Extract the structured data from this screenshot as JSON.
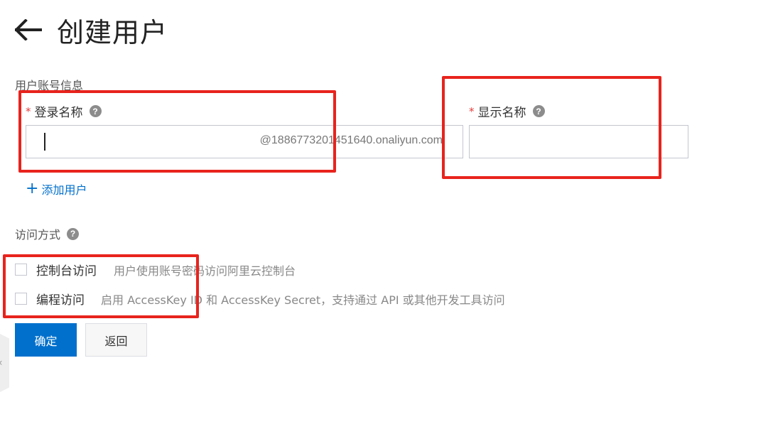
{
  "header": {
    "title": "创建用户"
  },
  "account_section": {
    "title": "用户账号信息"
  },
  "login_name": {
    "label": "登录名称",
    "required_mark": "*",
    "value": "",
    "suffix": "@1886773201451640.onaliyun.com"
  },
  "display_name": {
    "label": "显示名称",
    "required_mark": "*",
    "value": ""
  },
  "add_user": {
    "label": "添加用户"
  },
  "access_section": {
    "title": "访问方式"
  },
  "access_options": [
    {
      "label": "控制台访问",
      "description": "用户使用账号密码访问阿里云控制台",
      "checked": false
    },
    {
      "label": "编程访问",
      "description": "启用 AccessKey ID 和 AccessKey Secret，支持通过 API 或其他开发工具访问",
      "checked": false
    }
  ],
  "help_glyph": "?",
  "actions": {
    "confirm": "确定",
    "back": "返回"
  },
  "colors": {
    "primary": "#0070cc",
    "required": "#e63c3c",
    "highlight": "#e8231d"
  }
}
